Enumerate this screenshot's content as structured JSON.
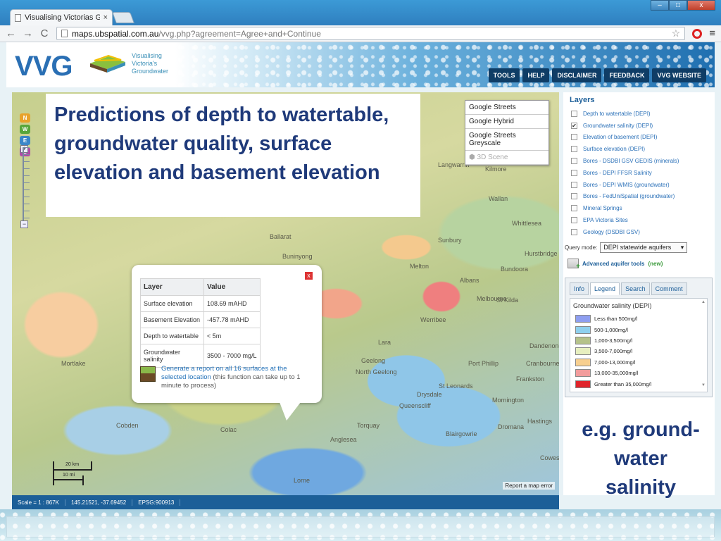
{
  "browser": {
    "tab_title": "Visualising Victorias Grou",
    "tab_close": "×",
    "url_host": "maps.ubspatial.com.au",
    "url_path": "/vvg.php?agreement=Agree+and+Continue",
    "nav_back": "←",
    "nav_forward": "→",
    "nav_reload": "C",
    "star": "☆",
    "menu": "≡",
    "window_buttons": [
      "–",
      "□",
      "x"
    ]
  },
  "header": {
    "logo": "VVG",
    "logo_sub": [
      "Visualising",
      "Victoria's",
      "Groundwater"
    ],
    "nav": [
      "TOOLS",
      "HELP",
      "DISCLAIMER",
      "FEEDBACK",
      "VVG WEBSITE"
    ]
  },
  "slide": {
    "title": "Predictions of depth to watertable, groundwater quality, surface elevation and basement elevation",
    "caption_lines": [
      "e.g. ground-",
      "water",
      "salinity"
    ]
  },
  "map": {
    "zoom_letters": [
      "N",
      "W",
      "E",
      "S"
    ],
    "zoom_plus": "+",
    "zoom_minus": "−",
    "map_types": [
      "Google Streets",
      "Google Hybrid",
      "Google Streets Greyscale",
      "3D Scene"
    ],
    "places": [
      "Langwarrin",
      "Kilmore",
      "Wallan",
      "Whittlesea",
      "Ballarat",
      "Buninyong",
      "Sunbury",
      "Melton",
      "Albans",
      "St Kilda",
      "Melbourne",
      "Werribee",
      "Geelong",
      "North Geelong",
      "Lara",
      "Frankston",
      "Port Phillip",
      "Mornington",
      "Drysdale",
      "St Leonards",
      "Queenscliff",
      "Torquay",
      "Anglesea",
      "Colac",
      "Cobden",
      "Mortlake",
      "Lorne",
      "Cowes",
      "Hastings",
      "Dromana",
      "Blairgowrie",
      "Dandenong",
      "Bundoora",
      "Hurstbridge",
      "Cranbourne"
    ],
    "scale_labels": [
      "20 km",
      "10 mi"
    ],
    "report_error": "Report a map error"
  },
  "popup": {
    "close": "x",
    "headers": [
      "Layer",
      "Value"
    ],
    "rows": [
      [
        "Surface elevation",
        "108.69 mAHD"
      ],
      [
        "Basement Elevation",
        "-457.78 mAHD"
      ],
      [
        "Depth to watertable",
        "< 5m"
      ],
      [
        "Groundwater salinity",
        "3500 - 7000 mg/L"
      ]
    ],
    "report_link": "Generate a report on all 16 surfaces at the selected location",
    "report_note": "(this function can take up to 1 minute to process)"
  },
  "status_bar": {
    "scale": "Scale = 1 : 867K",
    "coords": "145.21521, -37.69452",
    "epsg": "EPSG:900913"
  },
  "layers": {
    "heading": "Layers",
    "items": [
      {
        "label": "Depth to watertable (DEPI)",
        "checked": false
      },
      {
        "label": "Groundwater salinity (DEPI)",
        "checked": true
      },
      {
        "label": "Elevation of basement (DEPI)",
        "checked": false
      },
      {
        "label": "Surface elevation (DEPI)",
        "checked": false
      },
      {
        "label": "Bores - DSDBI GSV GEDIS (minerals)",
        "checked": false
      },
      {
        "label": "Bores - DEPI FFSR Salinity",
        "checked": false
      },
      {
        "label": "Bores - DEPI WMIS (groundwater)",
        "checked": false
      },
      {
        "label": "Bores - FedUniSpatial (groundwater)",
        "checked": false
      },
      {
        "label": "Mineral Springs",
        "checked": false
      },
      {
        "label": "EPA Victoria Sites",
        "checked": false
      },
      {
        "label": "Geology (DSDBI GSV)",
        "checked": false
      }
    ],
    "checkmark": "✔",
    "query_mode_label": "Query mode:",
    "query_mode_value": "DEPI statewide aquifers",
    "query_arrow": "▾",
    "advanced_tools": "Advanced aquifer tools",
    "advanced_new": "(new)"
  },
  "legend": {
    "tabs": [
      "Info",
      "Legend",
      "Search",
      "Comment"
    ],
    "title": "Groundwater salinity (DEPI)",
    "scroll_up": "▲",
    "scroll_down": "▼",
    "items": [
      {
        "label": "Less than 500mg/l",
        "color": "#8e9ef0"
      },
      {
        "label": "500-1,000mg/l",
        "color": "#8fd0ee"
      },
      {
        "label": "1,000-3,500mg/l",
        "color": "#b5c28a"
      },
      {
        "label": "3,500-7,000mg/l",
        "color": "#e7efbf"
      },
      {
        "label": "7,000-13,000mg/l",
        "color": "#f7cf8f"
      },
      {
        "label": "13,000-35,000mg/l",
        "color": "#f29c9c"
      },
      {
        "label": "Greater than 35,000mg/l",
        "color": "#e0242b"
      }
    ]
  }
}
